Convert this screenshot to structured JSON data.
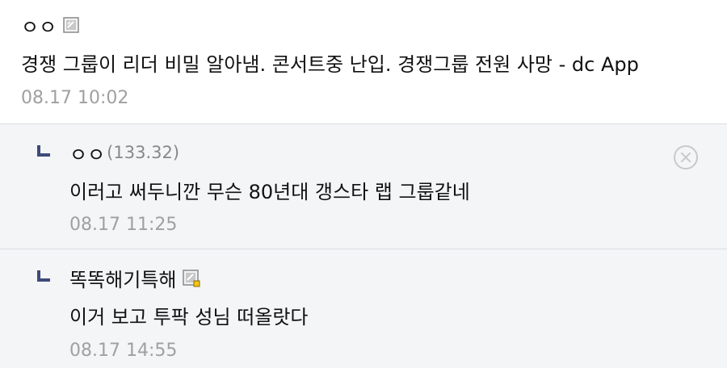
{
  "root_comment": {
    "nickname": "ㅇㅇ",
    "text": "경쟁 그룹이 리더 비밀 알아냄. 콘서트중 난입. 경쟁그룹 전원 사망 - dc App",
    "date": "08.17 10:02",
    "icon": "gallog-icon"
  },
  "replies": [
    {
      "nickname": "ㅇㅇ",
      "ip": "(133.32)",
      "text": "이러고 써두니깐 무슨 80년대 갱스타 랩 그룹같네",
      "date": "08.17 11:25",
      "has_delete": true
    },
    {
      "nickname": "똑똑해기특해",
      "text": "이거 보고 투팍 성님 떠올랏다",
      "date": "08.17 14:55",
      "icon": "gallog-icon-fixed"
    }
  ],
  "colors": {
    "reply_bg": "#f4f5f7",
    "reply_arrow": "#3f4a7a",
    "date": "#a0a0a0",
    "ip": "#888888"
  }
}
